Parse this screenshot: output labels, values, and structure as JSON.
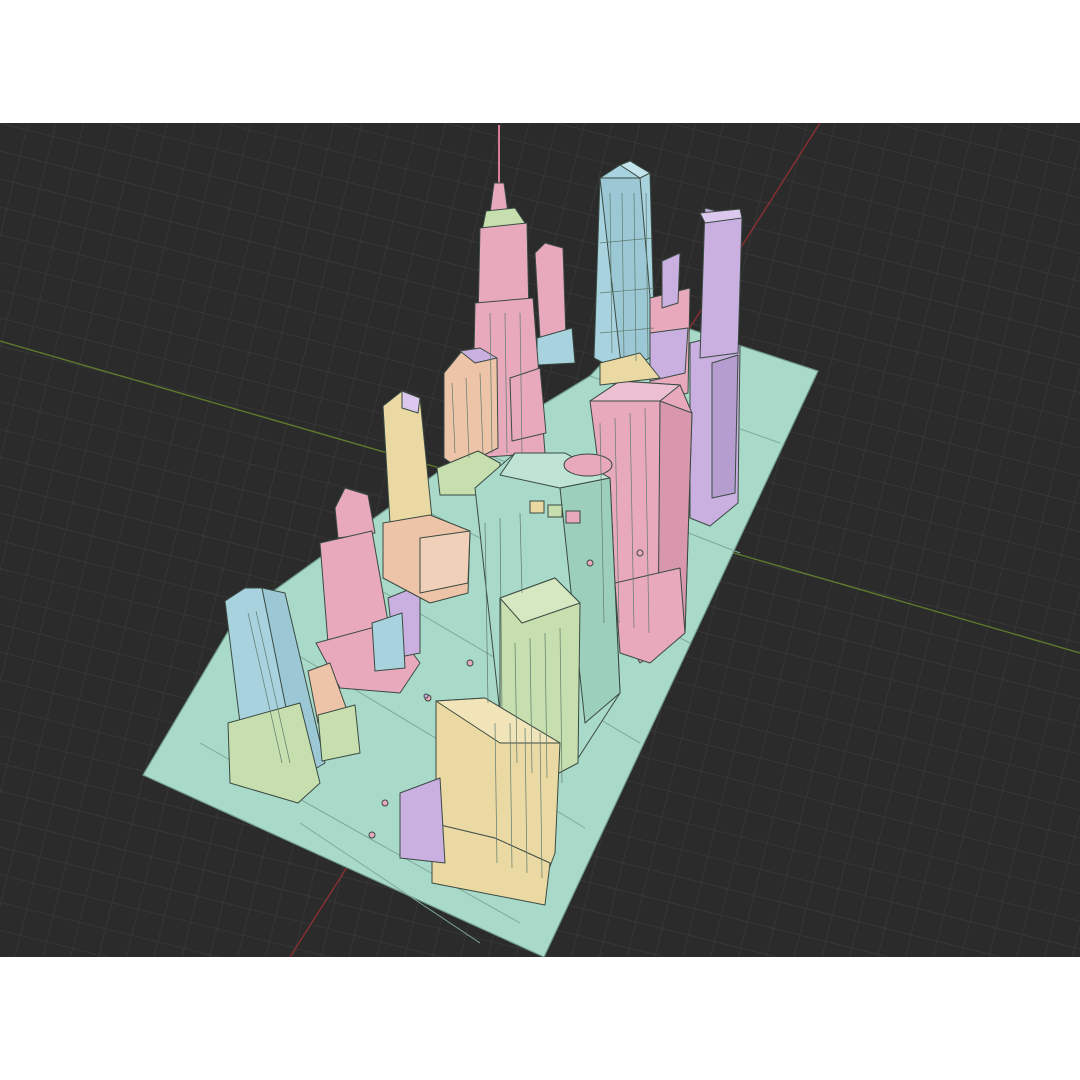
{
  "viewport": {
    "background": "#2b2b2b",
    "grid_color": "#3c3c3c",
    "x_axis_color": "#8a2e33",
    "y_axis_color": "#5d7a2c"
  },
  "scene": {
    "ground_color": "#a9d9c8",
    "palette": {
      "pink": "#e8a9bd",
      "peach": "#eec4a8",
      "yellow": "#ead9a3",
      "lilac": "#c9b0e0",
      "blue": "#a8d3de",
      "green": "#c7dfae",
      "wire": "#3a4a42"
    }
  }
}
